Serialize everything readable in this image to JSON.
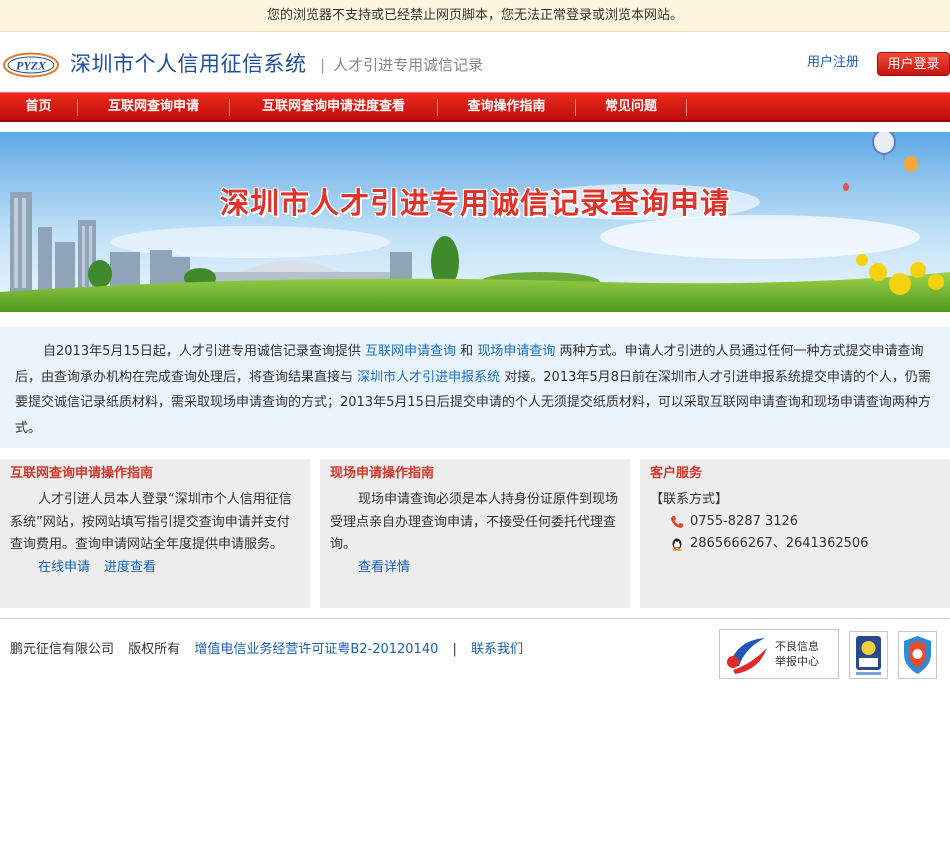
{
  "notice": "您的浏览器不支持或已经禁止网页脚本，您无法正常登录或浏览本网站。",
  "header": {
    "logo_text": "PYZX",
    "title": "深圳市个人信用征信系统",
    "subtitle": "人才引进专用诚信记录",
    "register_label": "用户注册",
    "login_label": "用户登录"
  },
  "nav": {
    "items": [
      {
        "label": "首页"
      },
      {
        "label": "互联网查询申请"
      },
      {
        "label": "互联网查询申请进度查看"
      },
      {
        "label": "查询操作指南"
      },
      {
        "label": "常见问题"
      }
    ]
  },
  "banner": {
    "title": "深圳市人才引进专用诚信记录查询申请"
  },
  "intro": {
    "p1": "自2013年5月15日起，人才引进专用诚信记录查询提供 ",
    "link1": "互联网申请查询",
    "p2": " 和 ",
    "link2": "现场申请查询",
    "p3": " 两种方式。申请人才引进的人员通过任何一种方式提交申请查询后，由查询承办机构在完成查询处理后，将查询结果直接与 ",
    "link3": "深圳市人才引进申报系统",
    "p4": " 对接。2013年5月8日前在深圳市人才引进申报系统提交申请的个人，仍需要提交诚信记录纸质材料，需采取现场申请查询的方式；2013年5月15日后提交申请的个人无须提交纸质材料，可以采取互联网申请查询和现场申请查询两种方式。"
  },
  "cards": {
    "online": {
      "title": "互联网查询申请操作指南",
      "body": "人才引进人员本人登录“深圳市个人信用征信系统”网站，按网站填写指引提交查询申请并支付查询费用。查询申请网站全年度提供申请服务。",
      "link_apply": "在线申请",
      "link_progress": "进度查看"
    },
    "onsite": {
      "title": "现场申请操作指南",
      "body": "现场申请查询必须是本人持身份证原件到现场受理点亲自办理查询申请，不接受任何委托代理查询。",
      "link_detail": "查看详情"
    },
    "service": {
      "title": "客户服务",
      "contact_head": "【联系方式】",
      "phone": "0755-8287 3126",
      "qq": "2865666267、2641362506"
    }
  },
  "footer": {
    "company": "鹏元征信有限公司",
    "rights": "版权所有",
    "license": "增值电信业务经营许可证粤B2-20120140",
    "separator": "|",
    "contact": "联系我们"
  },
  "badges": {
    "report_line1": "不良信息",
    "report_line2": "举报中心"
  },
  "colors": {
    "brand_blue": "#1c4fa0",
    "nav_red": "#d81c12",
    "link_blue": "#1a5fb4",
    "card_title_red": "#d2382c"
  }
}
